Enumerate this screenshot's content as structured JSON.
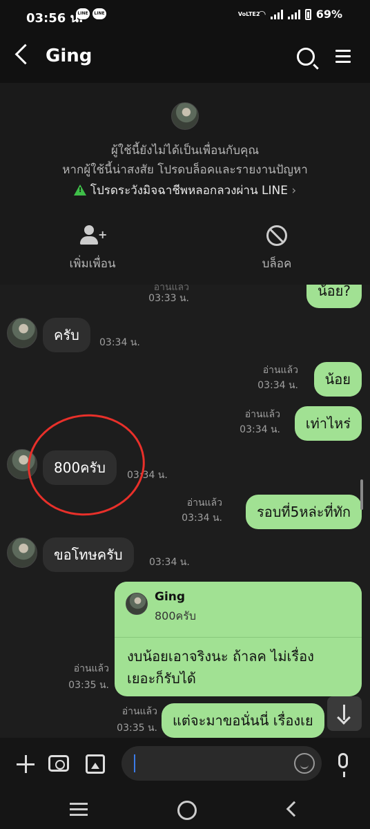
{
  "status_bar": {
    "time": "03:56 น.",
    "app_icon_1": "LINE",
    "app_icon_2": "LINE",
    "network": "VoLTE2",
    "battery": "69%"
  },
  "header": {
    "title": "Ging",
    "icons": [
      "back-icon",
      "search-icon",
      "menu-icon"
    ]
  },
  "banner": {
    "line1": "ผู้ใช้นี้ยังไม่ได้เป็นเพื่อนกับคุณ",
    "line2": "หากผู้ใช้นี้น่าสงสัย โปรดบล็อคและรายงานปัญหา",
    "warning": "โปรดระวังมิจฉาชีพหลอกลวงผ่าน LINE",
    "add_friend_label": "เพิ่มเพื่อน",
    "block_label": "บล็อค"
  },
  "messages": [
    {
      "dir": "out",
      "text": "น้อย?",
      "time": "03:33 น.",
      "read": "อ่านแล้ว"
    },
    {
      "dir": "in",
      "text": "ครับ",
      "time": "03:34 น."
    },
    {
      "dir": "out",
      "text": "น้อย",
      "time": "03:34 น.",
      "read": "อ่านแล้ว"
    },
    {
      "dir": "out",
      "text": "เท่าไหร่",
      "time": "03:34 น.",
      "read": "อ่านแล้ว"
    },
    {
      "dir": "in",
      "text": "800ครับ",
      "time": "03:34 น."
    },
    {
      "dir": "out",
      "text": "รอบที่5หล่ะที่ทัก",
      "time": "03:34 น.",
      "read": "อ่านแล้ว"
    },
    {
      "dir": "in",
      "text": "ขอโทษครับ",
      "time": "03:34 น."
    },
    {
      "dir": "out",
      "reply_to_name": "Ging",
      "reply_to_text": "800ครับ",
      "text_line1": "งบน้อยเอาจริงนะ ถ้าลค ไม่เรื่อง",
      "text_line2": "เยอะก็รับได้",
      "time": "03:35 น.",
      "read": "อ่านแล้ว"
    },
    {
      "dir": "out",
      "text": "แต่จะมาขอนั่นนี่ เรื่องเย",
      "time": "03:35 น.",
      "read": "อ่านแล้ว"
    }
  ],
  "input": {
    "placeholder": "",
    "value": ""
  },
  "colors": {
    "outgoing_bubble": "#a1e193",
    "incoming_bubble": "#2e2e2e",
    "background": "#1d1d1d",
    "annotation": "#e8302a"
  }
}
